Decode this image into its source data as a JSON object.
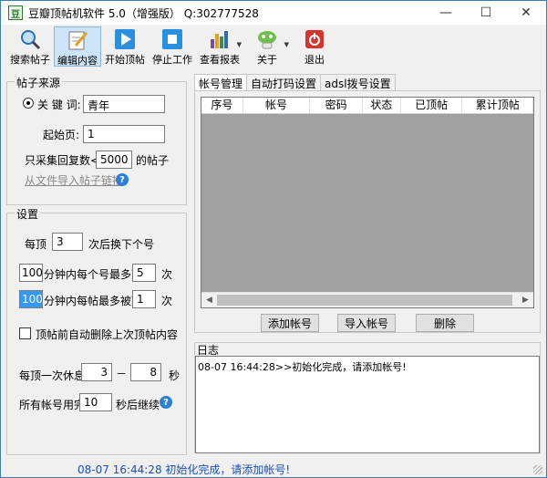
{
  "window": {
    "title": "豆瓣顶帖机软件 5.0（增强版） Q:302777528",
    "icon_text": "豆"
  },
  "toolbar": {
    "buttons": [
      {
        "label": "搜索帖子",
        "icon": "magnifier-icon"
      },
      {
        "label": "编辑内容",
        "icon": "pencil-note-icon"
      },
      {
        "label": "开始顶帖",
        "icon": "play-icon"
      },
      {
        "label": "停止工作",
        "icon": "stop-icon"
      },
      {
        "label": "查看报表",
        "icon": "bar-chart-icon"
      },
      {
        "label": "关于",
        "icon": "mascot-icon"
      },
      {
        "label": "退出",
        "icon": "power-icon"
      }
    ]
  },
  "source": {
    "title": "帖子来源",
    "keyword_label": "关 键 词:",
    "keyword_value": "青年",
    "start_page_label": "起始页:",
    "start_page_value": "1",
    "max_reply_prefix": "只采集回复数<=",
    "max_reply_value": "5000",
    "max_reply_suffix": "的帖子",
    "import_link": "从文件导入帖子链接"
  },
  "settings": {
    "title": "设置",
    "per_top_prefix": "每顶",
    "per_top_value": "3",
    "per_top_suffix": "次后换下个号",
    "acct_minutes_value": "100",
    "acct_mid": "分钟内每个号最多顶",
    "acct_max_value": "5",
    "acct_suffix": "次",
    "post_minutes_value": "100",
    "post_mid": "分钟内每帖最多被顶",
    "post_max_value": "1",
    "post_suffix": "次",
    "auto_delete_label": "顶帖前自动删除上次顶帖内容",
    "rest_prefix": "每顶一次休息",
    "rest_min": "3",
    "rest_dash": "－",
    "rest_max": "8",
    "rest_suffix": "秒",
    "continue_prefix": "所有帐号用完",
    "continue_value": "10",
    "continue_suffix": "秒后继续"
  },
  "tabs": [
    "帐号管理",
    "自动打码设置",
    "adsl拨号设置"
  ],
  "table": {
    "columns": [
      "序号",
      "帐号",
      "密码",
      "状态",
      "已顶帖",
      "累计顶帖"
    ]
  },
  "account_buttons": {
    "add": "添加帐号",
    "import": "导入帐号",
    "delete": "删除"
  },
  "log": {
    "title": "日志",
    "entries": [
      "08-07 16:44:28>>初始化完成，请添加帐号!"
    ]
  },
  "status_text": "08-07 16:44:28 初始化完成，请添加帐号!",
  "colors": {
    "accent": "#2b7fd4",
    "status_text": "#1a4fbf",
    "selected": "#3399ff"
  }
}
